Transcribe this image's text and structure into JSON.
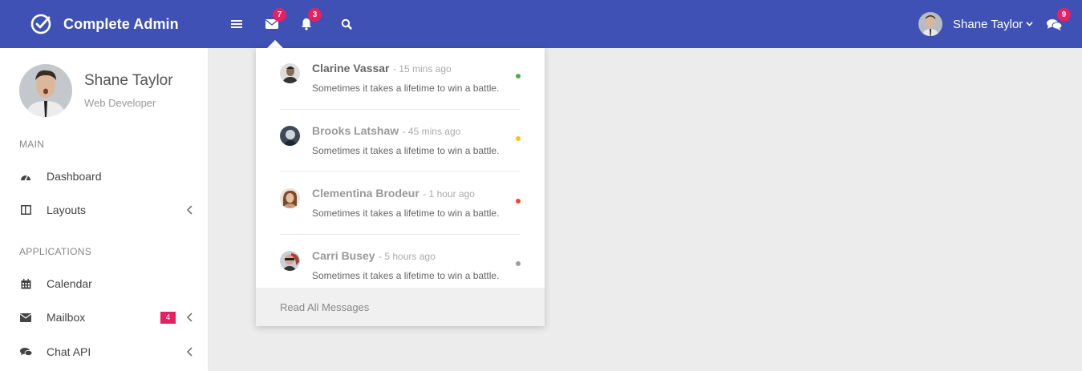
{
  "app": {
    "title": "Complete Admin"
  },
  "topbar": {
    "messages_count": "7",
    "notifications_count": "3",
    "chat_count": "9",
    "user_name": "Shane Taylor"
  },
  "sidebar": {
    "profile": {
      "name": "Shane Taylor",
      "role": "Web Developer"
    },
    "sections": [
      {
        "label": "MAIN",
        "items": [
          {
            "label": "Dashboard",
            "icon": "dashboard-icon"
          },
          {
            "label": "Layouts",
            "icon": "layout-icon",
            "has_submenu": true
          }
        ]
      },
      {
        "label": "APPLICATIONS",
        "items": [
          {
            "label": "Calendar",
            "icon": "calendar-icon"
          },
          {
            "label": "Mailbox",
            "icon": "envelope-icon",
            "badge": "4",
            "has_submenu": true
          },
          {
            "label": "Chat API",
            "icon": "chat-icon",
            "has_submenu": true
          }
        ]
      }
    ]
  },
  "messages_dropdown": {
    "messages": [
      {
        "name": "Clarine Vassar",
        "time": "- 15 mins ago",
        "text": "Sometimes it takes a lifetime to win a battle.",
        "status_color": "#4caf50"
      },
      {
        "name": "Brooks Latshaw",
        "time": "- 45 mins ago",
        "text": "Sometimes it takes a lifetime to win a battle.",
        "status_color": "#ffc107"
      },
      {
        "name": "Clementina Brodeur",
        "time": "- 1 hour ago",
        "text": "Sometimes it takes a lifetime to win a battle.",
        "status_color": "#f44336"
      },
      {
        "name": "Carri Busey",
        "time": "- 5 hours ago",
        "text": "Sometimes it takes a lifetime to win a battle.",
        "status_color": "#9e9e9e"
      }
    ],
    "footer_label": "Read All Messages"
  },
  "colors": {
    "primary": "#3f51b5",
    "badge": "#e91e63",
    "background": "#ececec"
  }
}
